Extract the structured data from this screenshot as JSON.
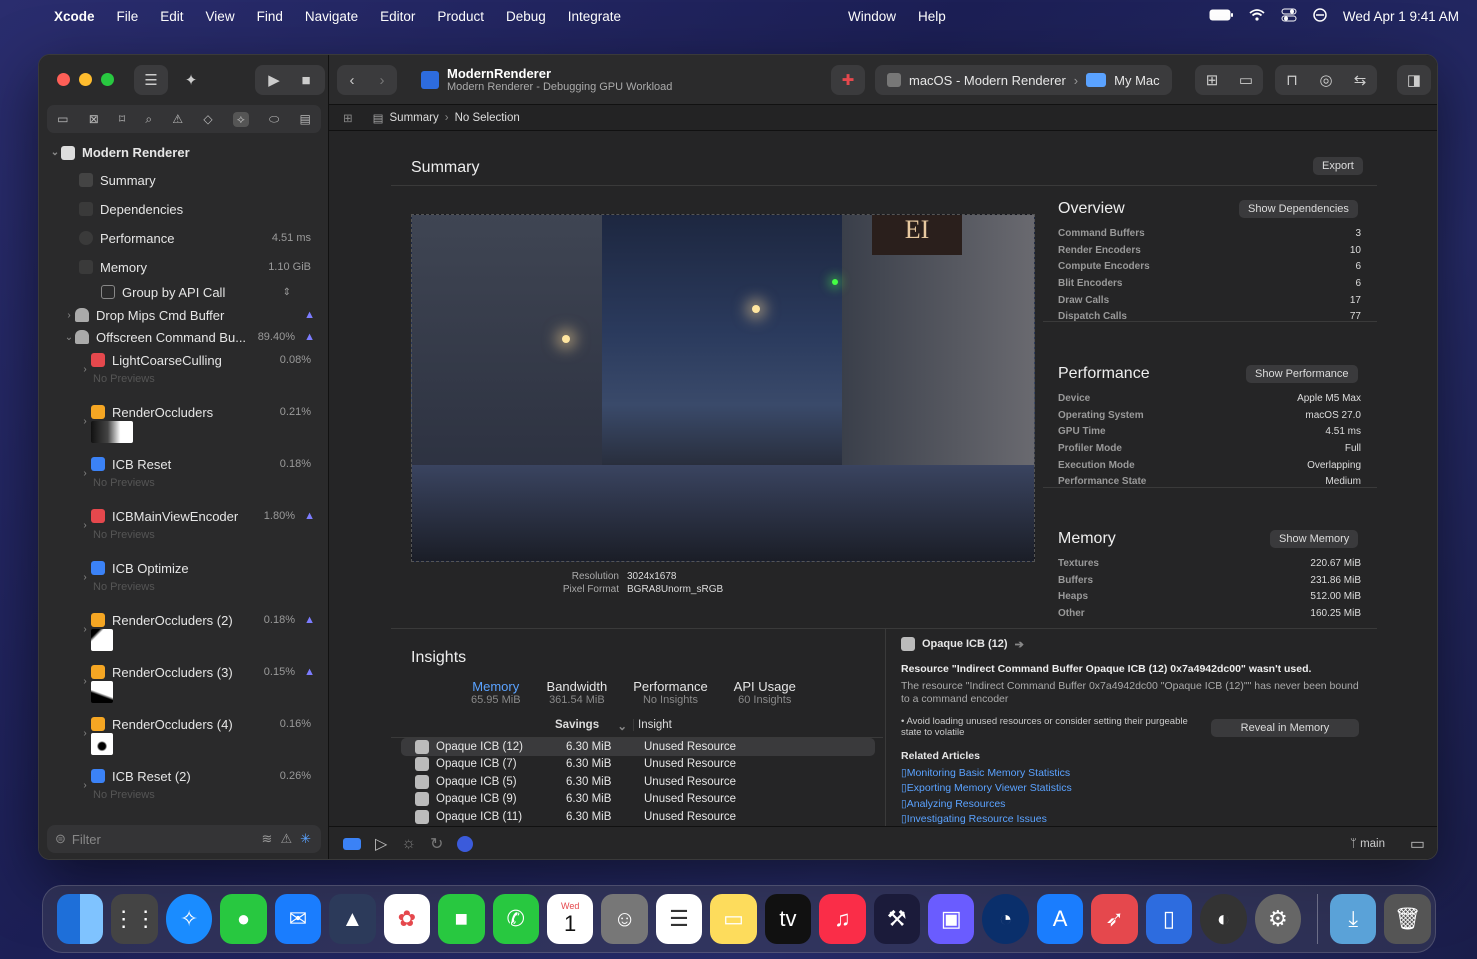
{
  "menubar": {
    "app": "Xcode",
    "items": [
      "File",
      "Edit",
      "View",
      "Find",
      "Navigate",
      "Editor",
      "Product",
      "Debug",
      "Integrate"
    ],
    "right_items": [
      "Window",
      "Help"
    ],
    "clock": "Wed Apr 1  9:41 AM"
  },
  "toolbar": {
    "project": "ModernRenderer",
    "subtitle": "Modern Renderer - Debugging GPU Workload",
    "scheme": "macOS - Modern Renderer",
    "destination": "My Mac"
  },
  "pathbar": {
    "crumb1": "Summary",
    "crumb2": "No Selection"
  },
  "sidebar": {
    "root": "Modern Renderer",
    "items": [
      {
        "label": "Summary"
      },
      {
        "label": "Dependencies"
      },
      {
        "label": "Performance",
        "value": "4.51 ms"
      },
      {
        "label": "Memory",
        "value": "1.10 GiB"
      }
    ],
    "group_by": "Group by API Call",
    "buffers": [
      {
        "label": "Drop Mips Cmd Buffer"
      },
      {
        "label": "Offscreen Command Bu...",
        "pct": "89.40%"
      }
    ],
    "encoders": [
      {
        "label": "LightCoarseCulling",
        "pct": "0.08%",
        "preview": "No Previews"
      },
      {
        "label": "RenderOccluders",
        "pct": "0.21%"
      },
      {
        "label": "ICB Reset",
        "pct": "0.18%",
        "preview": "No Previews"
      },
      {
        "label": "ICBMainViewEncoder",
        "pct": "1.80%",
        "preview": "No Previews"
      },
      {
        "label": "ICB Optimize",
        "pct": "",
        "preview": "No Previews"
      },
      {
        "label": "RenderOccluders (2)",
        "pct": "0.18%"
      },
      {
        "label": "RenderOccluders (3)",
        "pct": "0.15%"
      },
      {
        "label": "RenderOccluders (4)",
        "pct": "0.16%"
      },
      {
        "label": "ICB Reset (2)",
        "pct": "0.26%",
        "preview": "No Previews"
      }
    ],
    "filter_placeholder": "Filter"
  },
  "summary": {
    "title": "Summary",
    "export": "Export",
    "resolution_label": "Resolution",
    "resolution": "3024x1678",
    "format_label": "Pixel Format",
    "format": "BGRA8Unorm_sRGB"
  },
  "overview": {
    "title": "Overview",
    "button": "Show Dependencies",
    "rows": [
      [
        "Command Buffers",
        "3"
      ],
      [
        "Render Encoders",
        "10"
      ],
      [
        "Compute Encoders",
        "6"
      ],
      [
        "Blit Encoders",
        "6"
      ],
      [
        "Draw Calls",
        "17"
      ],
      [
        "Dispatch Calls",
        "77"
      ]
    ]
  },
  "performance": {
    "title": "Performance",
    "button": "Show Performance",
    "rows": [
      [
        "Device",
        "Apple M5 Max"
      ],
      [
        "Operating System",
        "macOS 27.0"
      ],
      [
        "GPU Time",
        "4.51 ms"
      ],
      [
        "Profiler Mode",
        "Full"
      ],
      [
        "Execution Mode",
        "Overlapping"
      ],
      [
        "Performance State",
        "Medium"
      ]
    ]
  },
  "memory": {
    "title": "Memory",
    "button": "Show Memory",
    "rows": [
      [
        "Textures",
        "220.67 MiB"
      ],
      [
        "Buffers",
        "231.86 MiB"
      ],
      [
        "Heaps",
        "512.00 MiB"
      ],
      [
        "Other",
        "160.25 MiB"
      ]
    ]
  },
  "insights": {
    "title": "Insights",
    "tabs": [
      {
        "label": "Memory",
        "sub": "65.95 MiB"
      },
      {
        "label": "Bandwidth",
        "sub": "361.54 MiB"
      },
      {
        "label": "Performance",
        "sub": "No Insights"
      },
      {
        "label": "API Usage",
        "sub": "60 Insights"
      }
    ],
    "col_savings": "Savings",
    "col_insight": "Insight",
    "rows": [
      [
        "Opaque ICB (12)",
        "6.30 MiB",
        "Unused Resource"
      ],
      [
        "Opaque ICB (7)",
        "6.30 MiB",
        "Unused Resource"
      ],
      [
        "Opaque ICB (5)",
        "6.30 MiB",
        "Unused Resource"
      ],
      [
        "Opaque ICB (9)",
        "6.30 MiB",
        "Unused Resource"
      ],
      [
        "Opaque ICB (11)",
        "6.30 MiB",
        "Unused Resource"
      ]
    ]
  },
  "detail": {
    "title": "Opaque ICB (12)",
    "headline": "Resource \"Indirect Command Buffer Opaque ICB (12) 0x7a4942dc00\" wasn't used.",
    "body": "The resource \"Indirect Command Buffer 0x7a4942dc00 \"Opaque ICB (12)\"\" has never been bound to a command encoder",
    "bullet": "• Avoid loading unused resources or consider setting their purgeable state to volatile",
    "reveal": "Reveal in Memory",
    "related": "Related Articles",
    "links": [
      "Monitoring Basic Memory Statistics",
      "Exporting Memory Viewer Statistics",
      "Analyzing Resources",
      "Investigating Resource Issues"
    ]
  },
  "bottombar": {
    "branch": "main"
  },
  "dock": {
    "calendar_day": "Wed",
    "calendar_date": "1"
  }
}
